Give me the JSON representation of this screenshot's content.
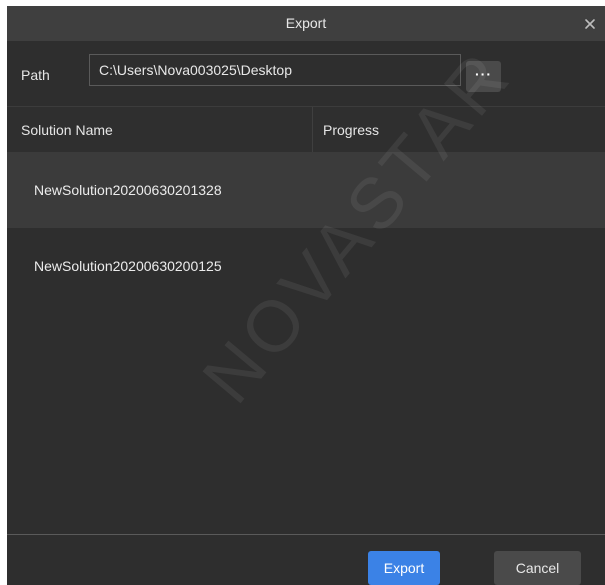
{
  "dialog": {
    "title": "Export",
    "close_icon": "close-icon"
  },
  "path": {
    "label": "Path",
    "value": "C:\\Users\\Nova003025\\Desktop",
    "browse_label": "···"
  },
  "table": {
    "columns": [
      "Solution Name",
      "Progress"
    ],
    "rows": [
      {
        "name": "NewSolution20200630201328",
        "progress": ""
      },
      {
        "name": "NewSolution20200630200125",
        "progress": ""
      }
    ]
  },
  "watermark": "NOVASTAR",
  "footer": {
    "export_label": "Export",
    "cancel_label": "Cancel"
  },
  "colors": {
    "accent": "#3b82e6",
    "background": "#2e2e2e",
    "selected_row": "#3b3b3b",
    "titlebar": "#3f3f3f"
  }
}
